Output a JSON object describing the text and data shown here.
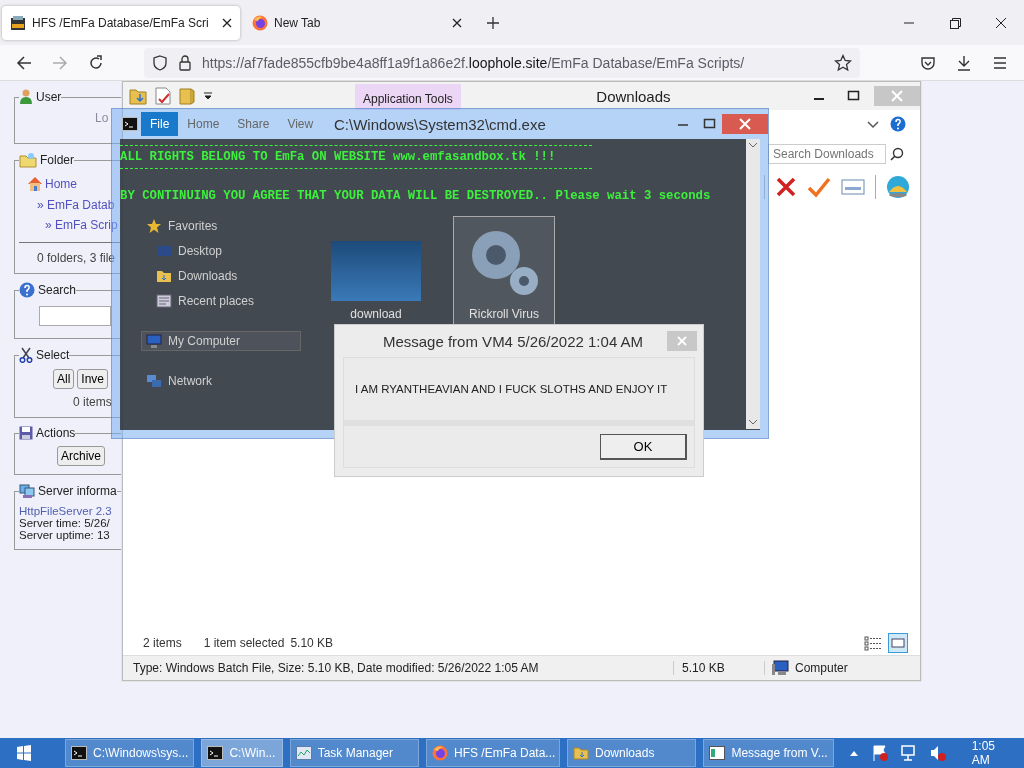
{
  "browser": {
    "tabs": [
      {
        "title": "HFS /EmFa Database/EmFa Scri",
        "kind": "hfs",
        "selected": true
      },
      {
        "title": "New Tab",
        "kind": "firefox",
        "selected": false
      }
    ],
    "url": {
      "prefix": "https://af7fade855cfb9be4a8ff1a9f1a86e2f.",
      "host": "loophole.site",
      "path": "/EmFa Database/EmFa Scripts/"
    }
  },
  "hfs_panel": {
    "sections": [
      {
        "kind": "user",
        "title": "User",
        "text": "Lo"
      },
      {
        "kind": "folder",
        "title": "Folder",
        "links": [
          "Home",
          "» EmFa Datab",
          "» EmFa Scrip"
        ],
        "summary": "0 folders, 3 file"
      },
      {
        "kind": "search",
        "title": "Search"
      },
      {
        "kind": "select",
        "title": "Select",
        "buttons": [
          "All",
          "Inve"
        ],
        "summary": "0 items"
      },
      {
        "kind": "actions",
        "title": "Actions",
        "buttons": [
          "Archive"
        ]
      },
      {
        "kind": "server",
        "title": "Server informa",
        "link": "HttpFileServer 2.3",
        "lines": [
          "Server time: 5/26/",
          "Server uptime: 13"
        ]
      }
    ]
  },
  "explorer": {
    "title": "Downloads",
    "context_tab": "Application Tools",
    "ribbon_tabs": [
      {
        "label": "File",
        "selected": true
      },
      {
        "label": "Home",
        "selected": false
      },
      {
        "label": "Share",
        "selected": false
      },
      {
        "label": "View",
        "selected": false
      }
    ],
    "search": {
      "placeholder": "Search Downloads"
    },
    "nav": [
      {
        "label": "Favorites",
        "kind": "star",
        "children": [
          {
            "label": "Desktop",
            "kind": "desktop"
          },
          {
            "label": "Downloads",
            "kind": "downloads"
          },
          {
            "label": "Recent places",
            "kind": "recent"
          }
        ]
      },
      {
        "label": "My Computer",
        "kind": "computer",
        "selected": true
      },
      {
        "label": "Network",
        "kind": "network",
        "selected": false
      }
    ],
    "files": [
      {
        "name": "download",
        "kind": "photo",
        "selected": false
      },
      {
        "name": "Rickroll Virus",
        "kind": "gear",
        "selected": true
      }
    ],
    "status": {
      "count": "2 items",
      "selection": "1 item selected",
      "size": "5.10 KB"
    },
    "details": {
      "description": "Type: Windows Batch File, Size: 5.10 KB, Date modified: 5/26/2022 1:05 AM",
      "size": "5.10 KB",
      "location": "Computer"
    }
  },
  "cmd": {
    "title": "C:\\Windows\\System32\\cmd.exe",
    "lines": [
      {
        "kind": "banner",
        "text": "ALL RIGHTS BELONG TO EmFa ON WEBSITE www.emfasandbox.tk !!!"
      },
      {
        "kind": "plain",
        "text": "BY CONTINUING YOU AGREE THAT YOUR DATA WILL BE DESTROYED.. Please wait 3 seconds"
      }
    ]
  },
  "message": {
    "title": "Message from VM4 5/26/2022 1:04 AM",
    "text": "I AM RYANTHEAVIAN AND I FUCK SLOTHS AND ENJOY IT",
    "button": "OK"
  },
  "taskbar": {
    "items": [
      {
        "label": "C:\\Windows\\sys...",
        "kind": "console",
        "selected": false
      },
      {
        "label": "C:\\Win...",
        "kind": "console",
        "selected": true
      },
      {
        "label": "Task Manager",
        "kind": "monitor",
        "selected": false
      },
      {
        "label": "HFS /EmFa Data...",
        "kind": "firefox",
        "selected": false
      },
      {
        "label": "Downloads",
        "kind": "folder",
        "selected": false
      },
      {
        "label": "Message from V...",
        "kind": "window",
        "selected": false
      }
    ],
    "clock": "1:05 AM"
  }
}
